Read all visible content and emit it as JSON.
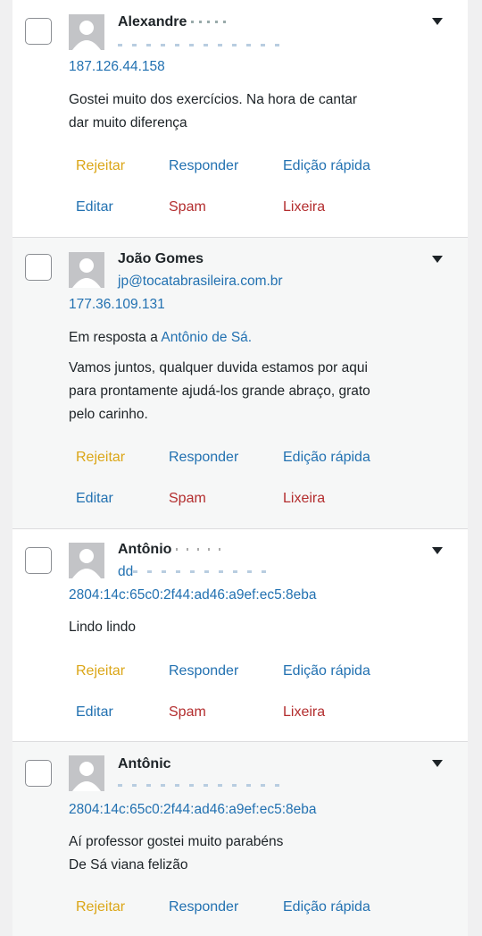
{
  "actions": {
    "approve_toggle": "Rejeitar",
    "reply": "Responder",
    "quick_edit": "Edição rápida",
    "edit": "Editar",
    "spam": "Spam",
    "trash": "Lixeira"
  },
  "comments": [
    {
      "author": "Alexandre",
      "email": "",
      "ip": "187.126.44.158",
      "in_reply_prefix": "",
      "in_reply_to": "",
      "text": [
        "Gostei muito dos exercícios. Na hora de cantar",
        "dar muito diferença"
      ]
    },
    {
      "author": "João Gomes",
      "email": "jp@tocatabrasileira.com.br",
      "ip": "177.36.109.131",
      "in_reply_prefix": "Em resposta a",
      "in_reply_to": "Antônio de Sá.",
      "text": [
        "Vamos juntos, qualquer duvida estamos por aqui",
        "para prontamente ajudá-los grande abraço, grato",
        "pelo carinho."
      ]
    },
    {
      "author": "Antônio",
      "email": "dd",
      "ip": "2804:14c:65c0:2f44:ad46:a9ef:ec5:8eba",
      "in_reply_prefix": "",
      "in_reply_to": "",
      "text": [
        "Lindo lindo"
      ]
    },
    {
      "author": "Antônic",
      "email": "",
      "ip": "2804:14c:65c0:2f44:ad46:a9ef:ec5:8eba",
      "in_reply_prefix": "",
      "in_reply_to": "",
      "text": [
        "Aí professor gostei muito parabéns",
        "De Sá viana felizão"
      ]
    }
  ]
}
